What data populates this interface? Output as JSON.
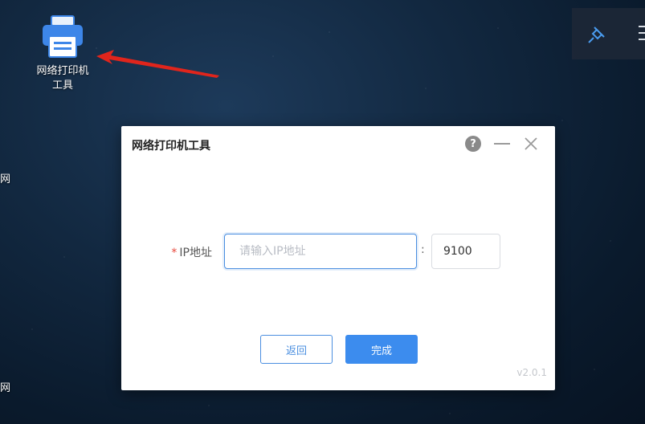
{
  "desktop": {
    "icon_label": "网络打印机\n工具",
    "edge_chars": [
      "网",
      "网"
    ]
  },
  "dialog": {
    "title": "网络打印机工具",
    "help_label": "?",
    "ip_field": {
      "required_mark": "*",
      "label": "IP地址",
      "placeholder": "请输入IP地址",
      "value": ""
    },
    "colon": ":",
    "port_field": {
      "value": "9100"
    },
    "back_label": "返回",
    "done_label": "完成",
    "version": "v2.0.1"
  },
  "colors": {
    "accent": "#3c8cee",
    "required": "#e8493c",
    "arrow": "#e0251c",
    "printer_icon": "#3d86e8"
  },
  "icons": [
    "printer-icon",
    "arrow-annotation",
    "pin-icon",
    "menu-icon",
    "help-icon",
    "minimize-icon",
    "close-icon"
  ]
}
